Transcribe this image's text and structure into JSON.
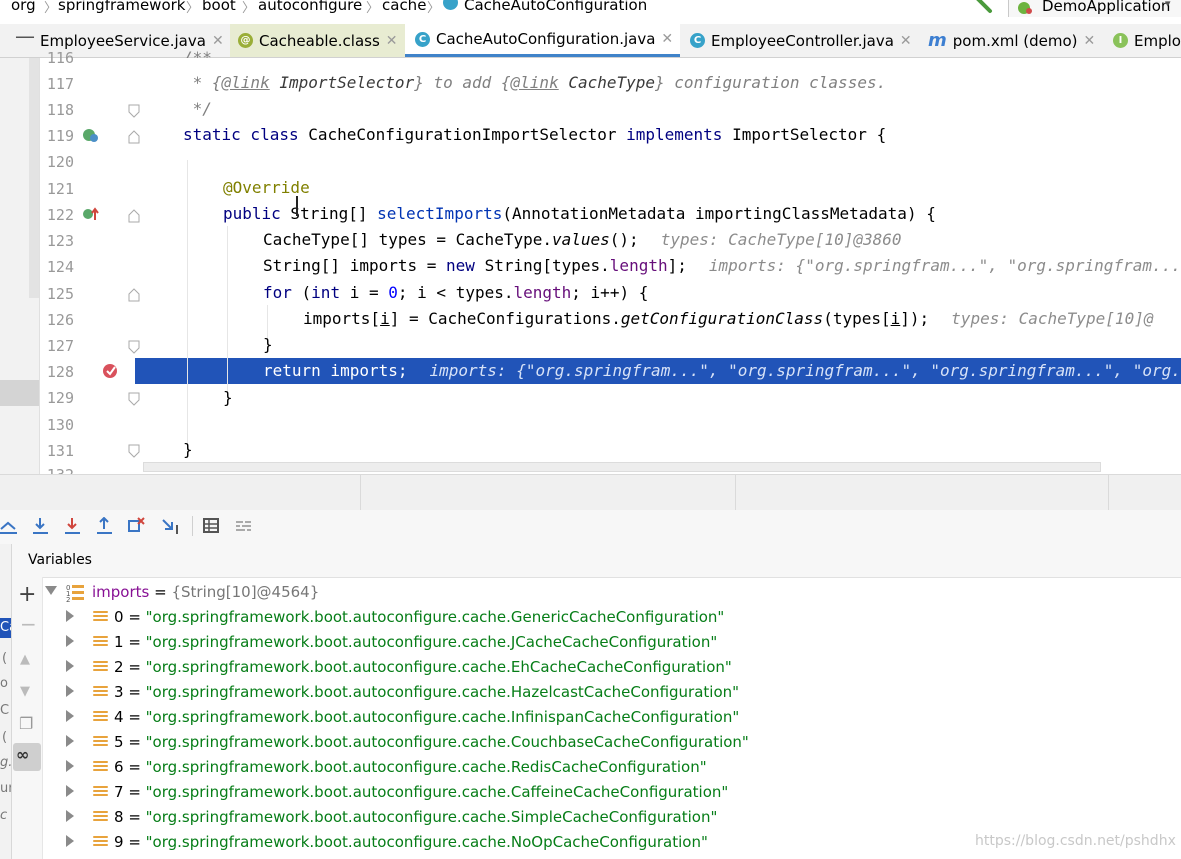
{
  "breadcrumb": {
    "items": [
      "org",
      "springframework",
      "boot",
      "autoconfigure",
      "cache",
      "CacheAutoConfiguration"
    ],
    "run_config": "DemoApplication"
  },
  "tabs": [
    {
      "label": "EmployeeService.java",
      "icon": "java-class-icon",
      "active": false
    },
    {
      "label": "Cacheable.class",
      "icon": "annotation-icon",
      "active": false
    },
    {
      "label": "CacheAutoConfiguration.java",
      "icon": "java-class-icon",
      "active": true
    },
    {
      "label": "EmployeeController.java",
      "icon": "java-class-icon",
      "active": false
    },
    {
      "label": "pom.xml (demo)",
      "icon": "maven-icon",
      "active": false
    },
    {
      "label": "Emplo",
      "icon": "interface-icon",
      "active": false
    }
  ],
  "editor": {
    "line_numbers": [
      "116",
      "117",
      "118",
      "119",
      "120",
      "121",
      "122",
      "123",
      "124",
      "125",
      "126",
      "127",
      "128",
      "129",
      "130",
      "131",
      "132"
    ],
    "lines": {
      "l116": "/**",
      "l117a": " * {",
      "l117b": "@link",
      "l117c": " ImportSelector",
      "l117d": "} to add {",
      "l117e": "@link",
      "l117f": " CacheType",
      "l117g": "} configuration classes.",
      "l118": " */",
      "l119a": "static class",
      "l119b": " CacheConfigurationImportSelector ",
      "l119c": "implements",
      "l119d": " ImportSelector {",
      "l121": "@Override",
      "l122a": "public",
      "l122b": " String[] ",
      "l122c": "selectImports",
      "l122d": "(AnnotationMetadata importingClassMetadata) {",
      "l123a": "CacheType[] types = CacheType.",
      "l123b": "values",
      "l123c": "();",
      "l123d": "types: CacheType[10]@3860",
      "l124a": "String[] imports = ",
      "l124b": "new",
      "l124c": " String[types.",
      "l124d": "length",
      "l124e": "];",
      "l124f": "imports: {\"org.springfram...\", \"org.springfram...\"",
      "l125a": "for",
      "l125b": " (",
      "l125c": "int",
      "l125d": " i = ",
      "l125e": "0",
      "l125f": "; i < types.",
      "l125g": "length",
      "l125h": "; i++) {",
      "l126a": "imports[",
      "l126b": "i",
      "l126c": "] = CacheConfigurations.",
      "l126d": "getConfigurationClass",
      "l126e": "(types[",
      "l126f": "i",
      "l126g": "]);",
      "l126h": "types: CacheType[10]@",
      "l127": "}",
      "l128a": "return imports;",
      "l128b": "imports: {\"org.springfram...\", \"org.springfram...\", \"org.springfram...\", \"org.",
      "l129": "}",
      "l131": "}"
    }
  },
  "debugger": {
    "panel_title": "Variables",
    "root": {
      "name": "imports",
      "eq": " = ",
      "type": "{String[10]@4564}"
    },
    "items": [
      {
        "index": "0",
        "value": "\"org.springframework.boot.autoconfigure.cache.GenericCacheConfiguration\""
      },
      {
        "index": "1",
        "value": "\"org.springframework.boot.autoconfigure.cache.JCacheCacheConfiguration\""
      },
      {
        "index": "2",
        "value": "\"org.springframework.boot.autoconfigure.cache.EhCacheCacheConfiguration\""
      },
      {
        "index": "3",
        "value": "\"org.springframework.boot.autoconfigure.cache.HazelcastCacheConfiguration\""
      },
      {
        "index": "4",
        "value": "\"org.springframework.boot.autoconfigure.cache.InfinispanCacheConfiguration\""
      },
      {
        "index": "5",
        "value": "\"org.springframework.boot.autoconfigure.cache.CouchbaseCacheConfiguration\""
      },
      {
        "index": "6",
        "value": "\"org.springframework.boot.autoconfigure.cache.RedisCacheConfiguration\""
      },
      {
        "index": "7",
        "value": "\"org.springframework.boot.autoconfigure.cache.CaffeineCacheConfiguration\""
      },
      {
        "index": "8",
        "value": "\"org.springframework.boot.autoconfigure.cache.SimpleCacheConfiguration\""
      },
      {
        "index": "9",
        "value": "\"org.springframework.boot.autoconfigure.cache.NoOpCacheConfiguration\""
      }
    ],
    "side_labels": [
      "Ca",
      "(",
      "o",
      "C",
      "(",
      "g.",
      "ur",
      "c"
    ],
    "watermark": "https://blog.csdn.net/pshdhx"
  },
  "colors": {
    "highlight": "#2154b8",
    "keyword": "#000080",
    "string_value": "#067d17",
    "comment": "#808080",
    "annotation": "#808000",
    "method": "#0033b3"
  }
}
